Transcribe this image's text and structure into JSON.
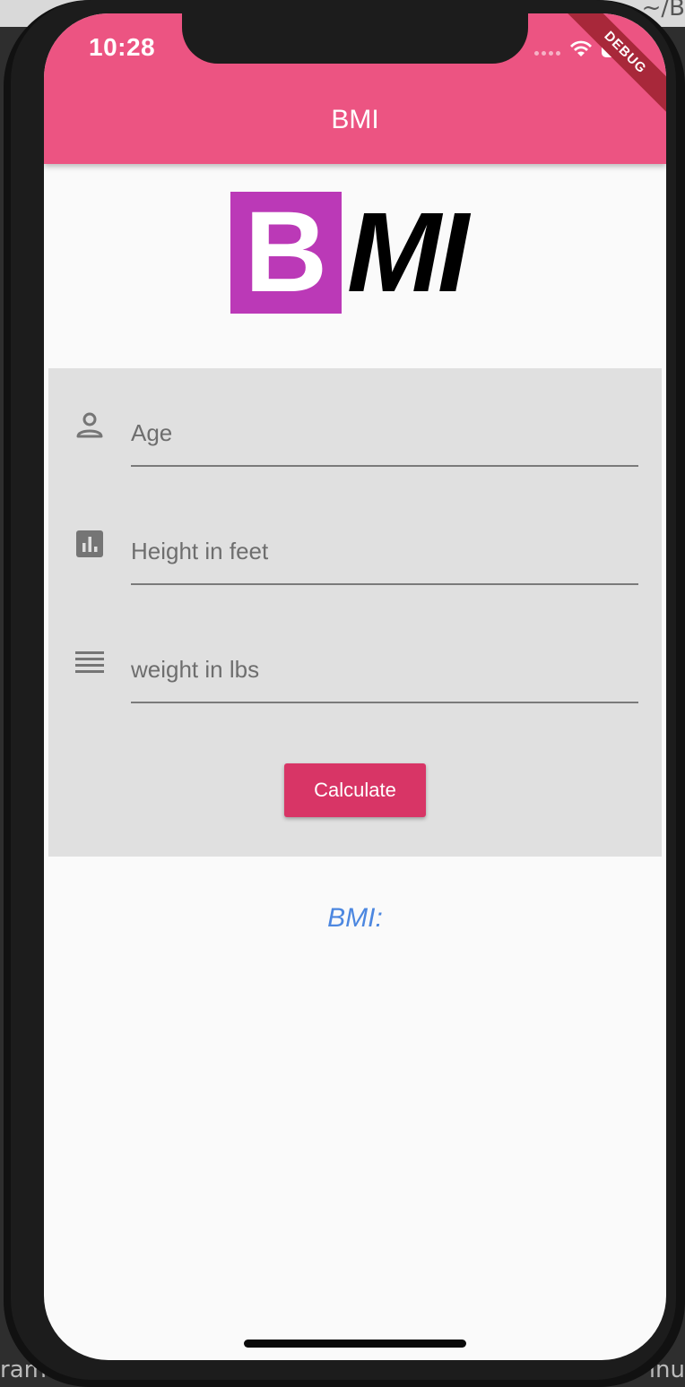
{
  "backdrop": {
    "left_fragment": "ram",
    "right_fragment": "inu",
    "path_fragment": "~/B"
  },
  "status_bar": {
    "time": "10:28",
    "debug_banner": "DEBUG"
  },
  "app_bar": {
    "title": "BMI"
  },
  "logo": {
    "letter_b": "B",
    "letters_mi": "MI",
    "box_color": "#bb39b7"
  },
  "form": {
    "fields": [
      {
        "placeholder": "Age",
        "icon": "person-icon"
      },
      {
        "placeholder": "Height in feet",
        "icon": "bar-chart-icon"
      },
      {
        "placeholder": "weight in lbs",
        "icon": "lines-icon"
      }
    ],
    "calculate_label": "Calculate"
  },
  "result": {
    "label": "BMI:"
  },
  "colors": {
    "accent": "#ec5482",
    "button": "#d83566",
    "result_text": "#4c87e0"
  }
}
